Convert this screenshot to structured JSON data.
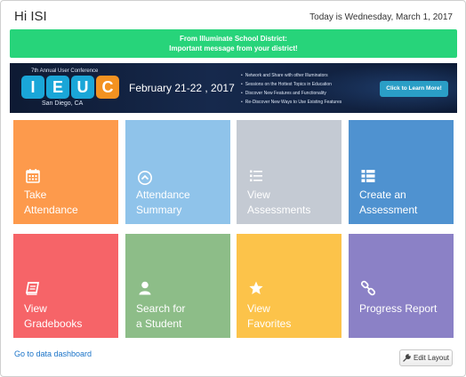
{
  "header": {
    "greeting": "Hi ISI",
    "date_text": "Today is Wednesday, March 1, 2017"
  },
  "message": {
    "line1": "From Illuminate School District:",
    "line2": "Important message from your district!",
    "color": "#27d47a"
  },
  "banner": {
    "conference_title": "7th Annual User Conference",
    "logo_letters": [
      {
        "letter": "I",
        "color": "#1aa6d8"
      },
      {
        "letter": "E",
        "color": "#1aa6d8"
      },
      {
        "letter": "U",
        "color": "#1aa6d8"
      },
      {
        "letter": "C",
        "color": "#f39221"
      }
    ],
    "location": "San Diego, CA",
    "dates": "February 21-22 , 2017",
    "bullets": [
      "Network and Share with other Illuminators",
      "Sessions on the Hottest Topics in Education",
      "Discover New Features and Functionality",
      "Re-Discover New Ways to Use Existing Features"
    ],
    "cta_label": "Click to Learn More!"
  },
  "tiles": [
    {
      "label": "Take\nAttendance",
      "icon": "calendar-icon",
      "color": "#fd9a4c"
    },
    {
      "label": "Attendance\nSummary",
      "icon": "chevron-circle-up-icon",
      "color": "#8fc3ea"
    },
    {
      "label": "View\nAssessments",
      "icon": "list-icon",
      "color": "#c4cad3"
    },
    {
      "label": "Create an\nAssessment",
      "icon": "list-alt-icon",
      "color": "#4f92d0"
    },
    {
      "label": "View\nGradebooks",
      "icon": "book-icon",
      "color": "#f66468"
    },
    {
      "label": "Search for\na Student",
      "icon": "user-icon",
      "color": "#8dbd88"
    },
    {
      "label": "View\nFavorites",
      "icon": "star-icon",
      "color": "#fcc34a"
    },
    {
      "label": "Progress Report",
      "icon": "link-icon",
      "color": "#8b81c6"
    }
  ],
  "footer": {
    "dashboard_link": "Go to data dashboard",
    "edit_layout_label": "Edit Layout"
  }
}
